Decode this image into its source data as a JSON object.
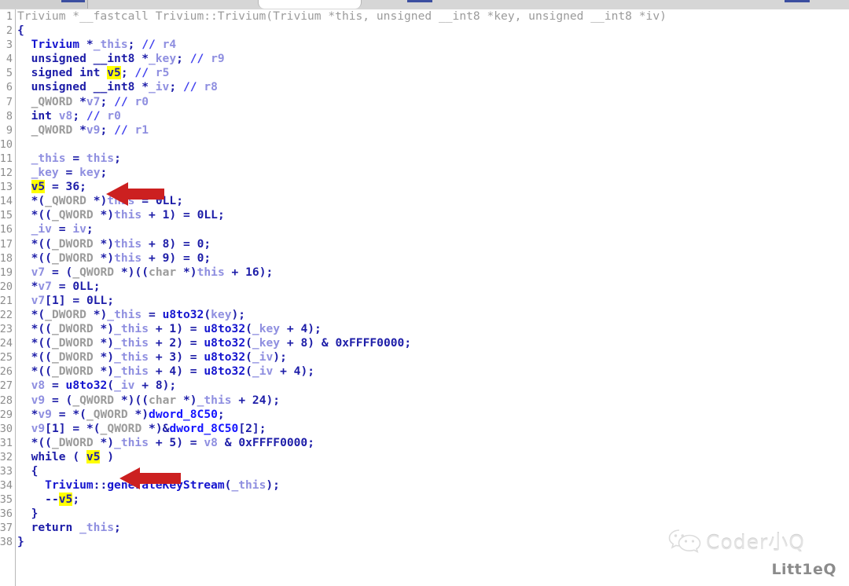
{
  "window": {
    "app": "ida-hexrays-pseudocode",
    "tabs": [
      {
        "name": "tab-1",
        "active": false
      },
      {
        "name": "tab-2",
        "active": true
      },
      {
        "name": "tab-3",
        "active": false
      }
    ]
  },
  "colors": {
    "background": "#ffffff",
    "gutter_text": "#8d8d8d",
    "keyword": "#1d1da8",
    "variable": "#8f8fe0",
    "comment": "#4040ee",
    "cast_type": "#9b9b9b",
    "function": "#1515cf",
    "global": "#1515ff",
    "highlight_bg": "#ffff00",
    "annotation_arrow": "#cc2020",
    "signature_line": "#9b9b9b"
  },
  "editor": {
    "signature": "Trivium *__fastcall Trivium::Trivium(Trivium *this, unsigned __int8 *key, unsigned __int8 *iv)",
    "highlighted_token": "v5",
    "line_numbers": [
      "1",
      "2",
      "3",
      "4",
      "5",
      "6",
      "7",
      "8",
      "9",
      "10",
      "11",
      "12",
      "13",
      "14",
      "15",
      "16",
      "17",
      "18",
      "19",
      "20",
      "21",
      "22",
      "23",
      "24",
      "25",
      "26",
      "27",
      "28",
      "29",
      "30",
      "31",
      "32",
      "33",
      "34",
      "35",
      "36",
      "37",
      "38"
    ],
    "lines": [
      {
        "n": "1",
        "text": "Trivium *__fastcall Trivium::Trivium(Trivium *this, unsigned __int8 *key, unsigned __int8 *iv)"
      },
      {
        "n": "2",
        "text": "{"
      },
      {
        "n": "3",
        "text": "  Trivium *_this; // r4"
      },
      {
        "n": "4",
        "text": "  unsigned __int8 *_key; // r9"
      },
      {
        "n": "5",
        "text": "  signed int v5; // r5"
      },
      {
        "n": "6",
        "text": "  unsigned __int8 *_iv; // r8"
      },
      {
        "n": "7",
        "text": "  _QWORD *v7; // r0"
      },
      {
        "n": "8",
        "text": "  int v8; // r0"
      },
      {
        "n": "9",
        "text": "  _QWORD *v9; // r1"
      },
      {
        "n": "10",
        "text": ""
      },
      {
        "n": "11",
        "text": "  _this = this;"
      },
      {
        "n": "12",
        "text": "  _key = key;"
      },
      {
        "n": "13",
        "text": "  v5 = 36;"
      },
      {
        "n": "14",
        "text": "  *(_QWORD *)this = 0LL;"
      },
      {
        "n": "15",
        "text": "  *((_QWORD *)this + 1) = 0LL;"
      },
      {
        "n": "16",
        "text": "  _iv = iv;"
      },
      {
        "n": "17",
        "text": "  *((_DWORD *)this + 8) = 0;"
      },
      {
        "n": "18",
        "text": "  *((_DWORD *)this + 9) = 0;"
      },
      {
        "n": "19",
        "text": "  v7 = (_QWORD *)((char *)this + 16);"
      },
      {
        "n": "20",
        "text": "  *v7 = 0LL;"
      },
      {
        "n": "21",
        "text": "  v7[1] = 0LL;"
      },
      {
        "n": "22",
        "text": "  *(_DWORD *)_this = u8to32(key);"
      },
      {
        "n": "23",
        "text": "  *((_DWORD *)_this + 1) = u8to32(_key + 4);"
      },
      {
        "n": "24",
        "text": "  *((_DWORD *)_this + 2) = u8to32(_key + 8) & 0xFFFF0000;"
      },
      {
        "n": "25",
        "text": "  *((_DWORD *)_this + 3) = u8to32(_iv);"
      },
      {
        "n": "26",
        "text": "  *((_DWORD *)_this + 4) = u8to32(_iv + 4);"
      },
      {
        "n": "27",
        "text": "  v8 = u8to32(_iv + 8);"
      },
      {
        "n": "28",
        "text": "  v9 = (_QWORD *)((char *)_this + 24);"
      },
      {
        "n": "29",
        "text": "  *v9 = *(_QWORD *)dword_8C50;"
      },
      {
        "n": "30",
        "text": "  v9[1] = *(_QWORD *)&dword_8C50[2];"
      },
      {
        "n": "31",
        "text": "  *((_DWORD *)_this + 5) = v8 & 0xFFFF0000;"
      },
      {
        "n": "32",
        "text": "  while ( v5 )"
      },
      {
        "n": "33",
        "text": "  {"
      },
      {
        "n": "34",
        "text": "    Trivium::generateKeyStream(_this);"
      },
      {
        "n": "35",
        "text": "    --v5;"
      },
      {
        "n": "36",
        "text": "  }"
      },
      {
        "n": "37",
        "text": "  return _this;"
      },
      {
        "n": "38",
        "text": "}"
      }
    ]
  },
  "annotations": [
    {
      "name": "arrow-v5-assignment",
      "points_to_line": "13",
      "points_to_text": "v5 = 36;"
    },
    {
      "name": "arrow-while-v5",
      "points_to_line": "32",
      "points_to_text": "while ( v5 )"
    }
  ],
  "watermark": {
    "logo": "wechat-icon",
    "brand": "Coder小Q",
    "handle": "Litt1eQ"
  }
}
